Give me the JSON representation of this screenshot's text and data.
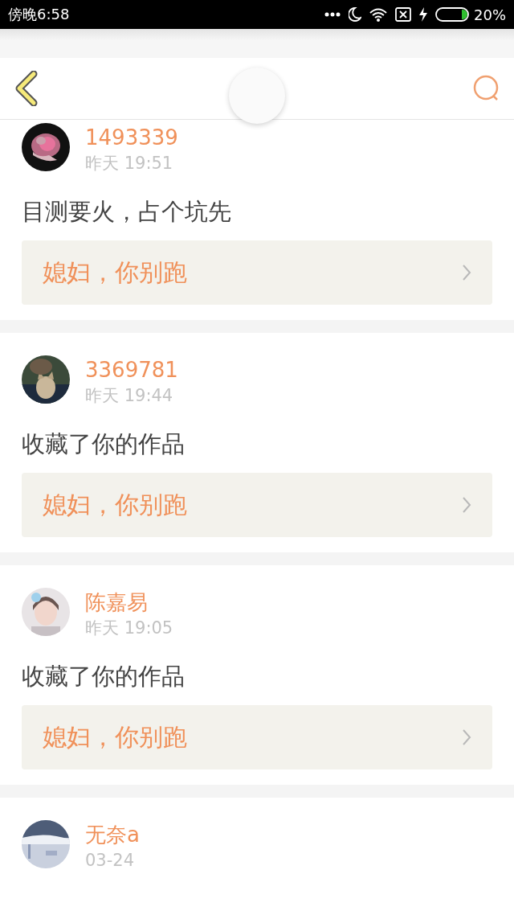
{
  "status_bar": {
    "time": "傍晚6:58",
    "battery": "20%"
  },
  "header": {
    "refreshing": true
  },
  "messages": [
    {
      "user": "1493339",
      "time": "昨天 19:51",
      "text": "目测要火，占个坑先",
      "work": "媳妇，你别跑"
    },
    {
      "user": "3369781",
      "time": "昨天 19:44",
      "text": "收藏了你的作品",
      "work": "媳妇，你别跑"
    },
    {
      "user": "陈嘉易",
      "time": "昨天 19:05",
      "text": "收藏了你的作品",
      "work": "媳妇，你别跑"
    },
    {
      "user": "无奈a",
      "time": "03-24"
    }
  ]
}
